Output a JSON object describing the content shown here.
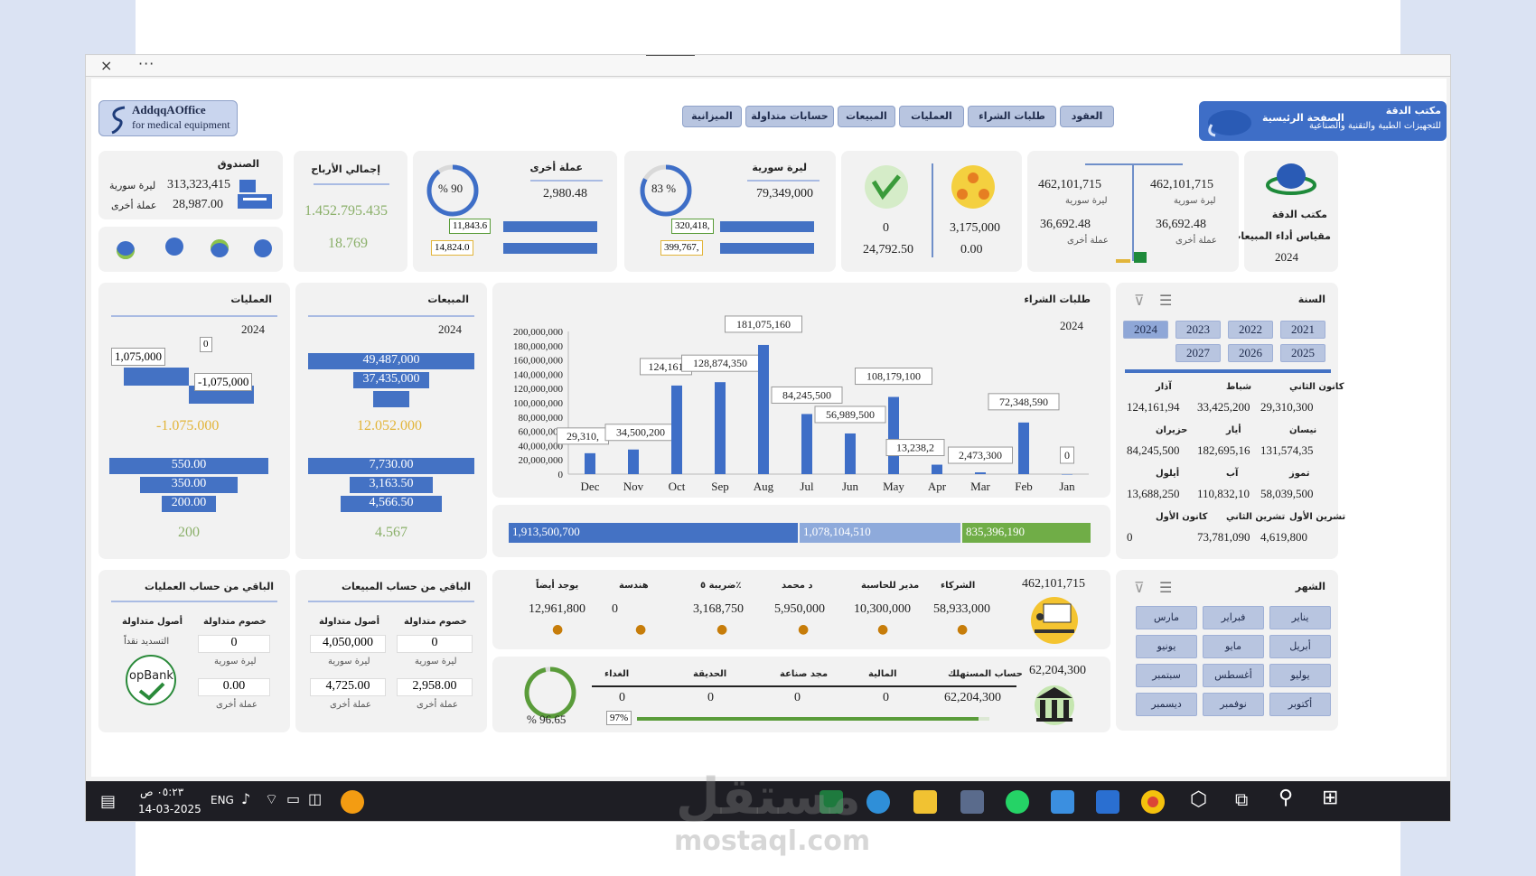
{
  "window": {
    "close": "×",
    "more": "···"
  },
  "header": {
    "logo_line1": "AddqqAOffice",
    "logo_line2": "for medical equipment",
    "nav": [
      "الميزانية",
      "حسابات متداولة",
      "المبيعات",
      "العمليات",
      "طلبات الشراء",
      "العقود"
    ],
    "home": "الصفحة الرئيسية",
    "office_name": "مكتب الدقة",
    "office_sub": "للتجهيزات الطبية والتقنية والصناعية"
  },
  "kpi": {
    "brand": {
      "name": "مكتب الدقة",
      "sub": "مقياس أداء المبيعات",
      "year": "2024"
    },
    "balance": {
      "left_top": "462,101,715",
      "left_top_lbl": "ليرة سورية",
      "left_bot": "36,692.48",
      "left_bot_lbl": "عملة أخرى",
      "right_top": "462,101,715",
      "right_top_lbl": "ليرة سورية",
      "right_bot": "36,692.48",
      "right_bot_lbl": "عملة أخرى"
    },
    "icons_card": {
      "right_top": "3,175,000",
      "right_bot": "0.00",
      "left_top": "0",
      "left_bot": "24,792.50"
    },
    "syp": {
      "title": "ليرة سورية",
      "value": "79,349,000",
      "pct": "83 %",
      "pct_value": 83,
      "bar1": "320,418,",
      "bar2": "399,767,"
    },
    "other": {
      "title": "عملة أخرى",
      "value": "2,980.48",
      "pct": "% 90",
      "pct_value": 90,
      "bar1": "11,843.6",
      "bar2": "14,824.0"
    },
    "profit": {
      "title": "إجمالي الأرباح",
      "v1": "1.452.795.435",
      "v2": "18.769"
    },
    "cash": {
      "title": "الصندوق",
      "v1": "313,323,415",
      "v1_lbl": "ليرة سورية",
      "v2": "28,987.00",
      "v2_lbl": "عملة أخرى"
    }
  },
  "year_filter": {
    "title": "السنة",
    "years": [
      "2021",
      "2022",
      "2023",
      "2024",
      "2025",
      "2026",
      "2027"
    ]
  },
  "month_table": [
    {
      "name": "كانون الثاني",
      "value": "29,310,300"
    },
    {
      "name": "شباط",
      "value": "33,425,200"
    },
    {
      "name": "آذار",
      "value": "124,161,94"
    },
    {
      "name": "نيسان",
      "value": "131,574,35"
    },
    {
      "name": "أيار",
      "value": "182,695,16"
    },
    {
      "name": "حزيران",
      "value": "84,245,500"
    },
    {
      "name": "تموز",
      "value": "58,039,500"
    },
    {
      "name": "آب",
      "value": "110,832,10"
    },
    {
      "name": "أيلول",
      "value": "13,688,250"
    },
    {
      "name": "تشرين الأول",
      "value": "4,619,800"
    },
    {
      "name": "تشرين الثاني",
      "value": "73,781,090"
    },
    {
      "name": "كانون الأول",
      "value": "0"
    }
  ],
  "month_filter": {
    "title": "الشهر",
    "months": [
      "يناير",
      "فبراير",
      "مارس",
      "أبريل",
      "مايو",
      "يونيو",
      "يوليو",
      "أغسطس",
      "سبتمبر",
      "أكتوبر",
      "نوفمبر",
      "ديسمبر"
    ]
  },
  "chart_data": {
    "type": "bar",
    "title": "طلبات الشراء",
    "year": "2024",
    "categories": [
      "Jan",
      "Feb",
      "Mar",
      "Apr",
      "May",
      "Jun",
      "Jul",
      "Aug",
      "Sep",
      "Oct",
      "Nov",
      "Dec"
    ],
    "values": [
      0,
      72348590,
      2473300,
      13238200,
      108179100,
      56989500,
      84245500,
      181075160,
      128874350,
      124161000,
      34500200,
      29310300
    ],
    "data_labels": [
      "0",
      "72,348,590",
      "2,473,300",
      "13,238,2",
      "108,179,100",
      "56,989,500",
      "84,245,500",
      "181,075,160",
      "128,874,350",
      "124,161",
      "34,500,200",
      "29,310,"
    ],
    "yticks": [
      "0",
      "20,000,000",
      "40,000,000",
      "60,000,000",
      "80,000,000",
      "100,000,000",
      "120,000,000",
      "140,000,000",
      "160,000,000",
      "180,000,000",
      "200,000,000"
    ],
    "ylim": [
      0,
      200000000
    ],
    "grid": false
  },
  "stack_bar": {
    "seg1": "1,913,500,700",
    "seg2": "1,078,104,510",
    "seg3": "835,396,190"
  },
  "sales": {
    "title": "المبيعات",
    "year": "2024",
    "bars": [
      "49,487,000",
      "37,435,000",
      ""
    ],
    "total": "12.052.000",
    "bars2": [
      "7,730.00",
      "3,163.50",
      "4,566.50"
    ],
    "total2": "4.567"
  },
  "ops": {
    "title": "العمليات",
    "year": "2024",
    "c1": "1,075,000",
    "c2": "0",
    "c3": "-1,075,000",
    "total": "-1.075.000",
    "bars2": [
      "550.00",
      "350.00",
      "200.00"
    ],
    "total2": "200"
  },
  "partners": {
    "total": "462,101,715",
    "cols": [
      {
        "title": "الشركاء",
        "value": "58,933,000"
      },
      {
        "title": "مدير للحاسبة",
        "value": "10,300,000"
      },
      {
        "title": "د محمد",
        "value": "5,950,000"
      },
      {
        "title": "ضريبة ٥٪",
        "value": "3,168,750"
      },
      {
        "title": "هندسة",
        "value": "0"
      },
      {
        "title": "يوجد أيضاً",
        "value": "12,961,800"
      }
    ]
  },
  "due": {
    "total": "62,204,300",
    "pct": "% 96.65",
    "pct_value": 96.65,
    "progress": "97%",
    "progress_value": 97,
    "cols": [
      {
        "title": "حساب المستهلك",
        "value": "62,204,300"
      },
      {
        "title": "المالية",
        "value": "0"
      },
      {
        "title": "مجد صناعة",
        "value": "0"
      },
      {
        "title": "الحديقة",
        "value": "0"
      },
      {
        "title": "الغداء",
        "value": "0"
      }
    ]
  },
  "rem_sales": {
    "title": "الباقي من حساب المبيعات",
    "h1": "خصوم متداولة",
    "h2": "أصول متداولة",
    "v1": "0",
    "v2": "4,050,000",
    "l1": "ليرة سورية",
    "l2": "ليرة سورية",
    "v3": "2,958.00",
    "v4": "4,725.00",
    "l3": "عملة أخرى",
    "l4": "عملة أخرى"
  },
  "rem_ops": {
    "title": "الباقي من حساب العمليات",
    "h1": "خصوم متداولة",
    "h2": "أصول متداولة",
    "sub": "التسديد نقداً",
    "v1": "0",
    "l1": "ليرة سورية",
    "v2": "0.00",
    "l2": "عملة أخرى",
    "logo": "opBank"
  },
  "taskbar": {
    "time": "٠٥:٢٣ ص",
    "date": "14-03-2025",
    "lang": "ENG"
  },
  "watermark": {
    "text": "مستقل",
    "url": "mostaql.com"
  }
}
